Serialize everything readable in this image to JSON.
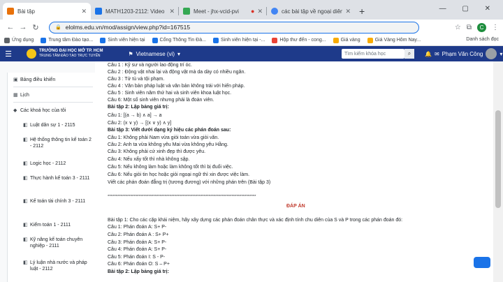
{
  "browser": {
    "tabs": [
      {
        "title": "Bài tập",
        "color": "#e8710a",
        "active": true
      },
      {
        "title": "MATH1203-2112: Video Confere",
        "color": "#1a73e8"
      },
      {
        "title": "Meet - jhx-vcid-pvi",
        "color": "#34a853"
      },
      {
        "title": "các bài tập về ngoại diên của ch",
        "color": "#4285f4"
      }
    ],
    "url": "elolms.edu.vn/mod/assign/view.php?id=167515",
    "bookmarks": [
      "Ứng dụng",
      "Trung tâm Đào tạo...",
      "Sinh viên hiện tại",
      "Cổng Thông Tin Đà...",
      "Sinh viên hiện tại -...",
      "Hộp thư đến - cong...",
      "Giá vàng",
      "Giá Vàng Hôm Nay..."
    ],
    "bookmarks_right": "Danh sách đọc",
    "profile_letter": "C"
  },
  "moodle": {
    "logo_line1": "TRƯỜNG ĐẠI HỌC MỞ TP. HCM",
    "logo_line2": "TRUNG TÂM ĐÀO TẠO TRỰC TUYẾN",
    "language": "Vietnamese (vi)",
    "search_placeholder": "Tìm kiếm khóa học",
    "user_name": "Phạm Văn Công"
  },
  "sidebar": {
    "items": [
      {
        "label": "Bảng điều khiển",
        "icon": "dashboard-icon",
        "glyph": "▣"
      },
      {
        "label": "Lịch",
        "icon": "calendar-icon",
        "glyph": "▦"
      },
      {
        "label": "Các khoá học của tôi",
        "icon": "courses-icon",
        "glyph": "🎓"
      }
    ],
    "courses": [
      "Luật dân sự 1 - 2115",
      "Hệ thống thông tin kế toán 2 - 2112",
      "Logic học - 2112",
      "Thực hành kế toán 3 - 2111",
      "Kế toán tài chính 3 - 2111",
      "Kiểm toán 1 - 2111",
      "Kỹ năng kế toán chuyên nghiệp - 2111",
      "Lý luận nhà nước và pháp luật - 2112"
    ]
  },
  "content": {
    "lines": [
      "Câu 1 : Kỹ sư và người lao động trí óc.",
      "Câu 2 : Động vật nhai lại và động vật mà da dày có nhiều ngăn.",
      "Câu 3 : Tử tù và tội phạm.",
      "Câu 4 : Văn bản pháp luật và văn bản không trái với hiến pháp.",
      "Câu 5 : Sinh viên năm thứ hai và sinh viên khoa luật học.",
      "Câu 6: Một số sinh viên nhưng phải là đoàn viên.",
      "Bài tập 2: Lập bảng giá trị:",
      "Câu 1: [(a → b) ∧ a] → a",
      "Câu 2: (x ∨ y) → [(x ∨ y) ∧ y]",
      "Bài tập 3: Viết dưới dạng ký hiệu các phán đoán sau:",
      "Câu 1: Không phải Nam vừa giỏi toán vừa giỏi văn.",
      "Câu 2: Anh ta vừa không yêu Mai vừa không yêu Hằng.",
      "Câu 3: Không phải cứ xinh đẹp thì được yêu.",
      "Câu 4: Nếu xấy tốt thì nhà không sập.",
      "Câu 5: Nếu không làm hoặc làm không tốt thì bị đuổi việc.",
      "Câu 6: Nếu giỏi tin học hoặc giỏi ngoại ngữ thì xin được việc làm.",
      "Viết các phán đoán đẳng trị (tương đương) với những phán trên (Bài tập 3)"
    ],
    "stars": "*******************************************************************************************",
    "answer_heading": "ĐÁP ÁN",
    "exercise1_intro": "Bài tập 1: Cho các cặp khái niệm, hãy xây dựng các phán đoán chân thực và xác định tính chu diên của S và P trong các phán đoán đó:",
    "answers": [
      "Câu 1: Phán đoán A: S+ P-",
      "Câu 2: Phán đoán A : S+ P+",
      "Câu 3: Phán đoán A: S+ P-",
      "Câu 4: Phán đoán A: S+ P-",
      "Câu 5: Phán đoán I: S - P-",
      "Câu 6: Phán đoán O: S – P+"
    ],
    "last_line": "Bài tập 2: Lập bảng giá trị:"
  }
}
